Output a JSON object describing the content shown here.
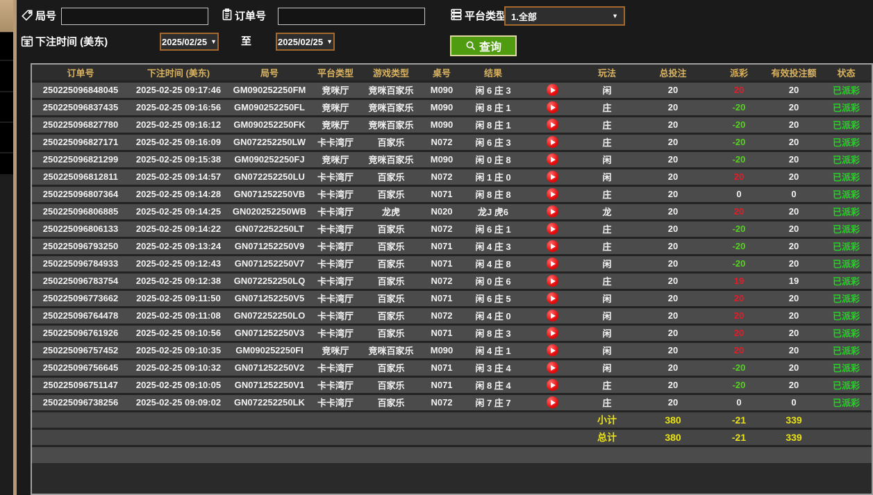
{
  "filters": {
    "round_label": "局号",
    "round_value": "",
    "order_label": "订单号",
    "order_value": "",
    "platform_label": "平台类型",
    "platform_value": "1.全部",
    "bet_time_label": "下注时间 (美东)",
    "date_from": "2025/02/25",
    "date_to": "2025/02/25",
    "to_label": "至",
    "search_label": "查询"
  },
  "colors": {
    "header_gold": "#d9b25f",
    "positive_red": "#e81a28",
    "negative_green": "#55d41e",
    "status_green": "#22d422",
    "totals_yellow": "#e9e217",
    "button_green": "#4f9c10",
    "dropdown_border_orange": "#a5692b",
    "rail_tan": "#b79a74"
  },
  "table": {
    "headers": [
      "订单号",
      "下注时间 (美东)",
      "局号",
      "平台类型",
      "游戏类型",
      "桌号",
      "结果",
      "玩法",
      "总投注",
      "派彩",
      "有效投注额",
      "状态"
    ],
    "rows": [
      {
        "order_no": "250225096848045",
        "bet_time": "2025-02-25 09:17:46",
        "round_no": "GM090252250FM",
        "platform": "竞咪厅",
        "game_type": "竞咪百家乐",
        "table_no": "M090",
        "result": "闲 6 庄 3",
        "play_type": "闲",
        "total_bet": "20",
        "payout": "20",
        "payout_class": "pos",
        "valid_bet": "20",
        "status": "已派彩"
      },
      {
        "order_no": "250225096837435",
        "bet_time": "2025-02-25 09:16:56",
        "round_no": "GM090252250FL",
        "platform": "竞咪厅",
        "game_type": "竞咪百家乐",
        "table_no": "M090",
        "result": "闲 8 庄 1",
        "play_type": "庄",
        "total_bet": "20",
        "payout": "-20",
        "payout_class": "neg",
        "valid_bet": "20",
        "status": "已派彩"
      },
      {
        "order_no": "250225096827780",
        "bet_time": "2025-02-25 09:16:12",
        "round_no": "GM090252250FK",
        "platform": "竞咪厅",
        "game_type": "竞咪百家乐",
        "table_no": "M090",
        "result": "闲 8 庄 1",
        "play_type": "庄",
        "total_bet": "20",
        "payout": "-20",
        "payout_class": "neg",
        "valid_bet": "20",
        "status": "已派彩"
      },
      {
        "order_no": "250225096827171",
        "bet_time": "2025-02-25 09:16:09",
        "round_no": "GN072252250LW",
        "platform": "卡卡湾厅",
        "game_type": "百家乐",
        "table_no": "N072",
        "result": "闲 6 庄 3",
        "play_type": "庄",
        "total_bet": "20",
        "payout": "-20",
        "payout_class": "neg",
        "valid_bet": "20",
        "status": "已派彩"
      },
      {
        "order_no": "250225096821299",
        "bet_time": "2025-02-25 09:15:38",
        "round_no": "GM090252250FJ",
        "platform": "竞咪厅",
        "game_type": "竞咪百家乐",
        "table_no": "M090",
        "result": "闲 0 庄 8",
        "play_type": "闲",
        "total_bet": "20",
        "payout": "-20",
        "payout_class": "neg",
        "valid_bet": "20",
        "status": "已派彩"
      },
      {
        "order_no": "250225096812811",
        "bet_time": "2025-02-25 09:14:57",
        "round_no": "GN072252250LU",
        "platform": "卡卡湾厅",
        "game_type": "百家乐",
        "table_no": "N072",
        "result": "闲 1 庄 0",
        "play_type": "闲",
        "total_bet": "20",
        "payout": "20",
        "payout_class": "pos",
        "valid_bet": "20",
        "status": "已派彩"
      },
      {
        "order_no": "250225096807364",
        "bet_time": "2025-02-25 09:14:28",
        "round_no": "GN071252250VB",
        "platform": "卡卡湾厅",
        "game_type": "百家乐",
        "table_no": "N071",
        "result": "闲 8 庄 8",
        "play_type": "庄",
        "total_bet": "20",
        "payout": "0",
        "payout_class": "zero",
        "valid_bet": "0",
        "status": "已派彩"
      },
      {
        "order_no": "250225096806885",
        "bet_time": "2025-02-25 09:14:25",
        "round_no": "GN020252250WB",
        "platform": "卡卡湾厅",
        "game_type": "龙虎",
        "table_no": "N020",
        "result": "龙J 虎6",
        "play_type": "龙",
        "total_bet": "20",
        "payout": "20",
        "payout_class": "pos",
        "valid_bet": "20",
        "status": "已派彩"
      },
      {
        "order_no": "250225096806133",
        "bet_time": "2025-02-25 09:14:22",
        "round_no": "GN072252250LT",
        "platform": "卡卡湾厅",
        "game_type": "百家乐",
        "table_no": "N072",
        "result": "闲 6 庄 1",
        "play_type": "庄",
        "total_bet": "20",
        "payout": "-20",
        "payout_class": "neg",
        "valid_bet": "20",
        "status": "已派彩"
      },
      {
        "order_no": "250225096793250",
        "bet_time": "2025-02-25 09:13:24",
        "round_no": "GN071252250V9",
        "platform": "卡卡湾厅",
        "game_type": "百家乐",
        "table_no": "N071",
        "result": "闲 4 庄 3",
        "play_type": "庄",
        "total_bet": "20",
        "payout": "-20",
        "payout_class": "neg",
        "valid_bet": "20",
        "status": "已派彩"
      },
      {
        "order_no": "250225096784933",
        "bet_time": "2025-02-25 09:12:43",
        "round_no": "GN071252250V7",
        "platform": "卡卡湾厅",
        "game_type": "百家乐",
        "table_no": "N071",
        "result": "闲 4 庄 8",
        "play_type": "闲",
        "total_bet": "20",
        "payout": "-20",
        "payout_class": "neg",
        "valid_bet": "20",
        "status": "已派彩"
      },
      {
        "order_no": "250225096783754",
        "bet_time": "2025-02-25 09:12:38",
        "round_no": "GN072252250LQ",
        "platform": "卡卡湾厅",
        "game_type": "百家乐",
        "table_no": "N072",
        "result": "闲 0 庄 6",
        "play_type": "庄",
        "total_bet": "20",
        "payout": "19",
        "payout_class": "pos",
        "valid_bet": "19",
        "status": "已派彩"
      },
      {
        "order_no": "250225096773662",
        "bet_time": "2025-02-25 09:11:50",
        "round_no": "GN071252250V5",
        "platform": "卡卡湾厅",
        "game_type": "百家乐",
        "table_no": "N071",
        "result": "闲 6 庄 5",
        "play_type": "闲",
        "total_bet": "20",
        "payout": "20",
        "payout_class": "pos",
        "valid_bet": "20",
        "status": "已派彩"
      },
      {
        "order_no": "250225096764478",
        "bet_time": "2025-02-25 09:11:08",
        "round_no": "GN072252250LO",
        "platform": "卡卡湾厅",
        "game_type": "百家乐",
        "table_no": "N072",
        "result": "闲 4 庄 0",
        "play_type": "闲",
        "total_bet": "20",
        "payout": "20",
        "payout_class": "pos",
        "valid_bet": "20",
        "status": "已派彩"
      },
      {
        "order_no": "250225096761926",
        "bet_time": "2025-02-25 09:10:56",
        "round_no": "GN071252250V3",
        "platform": "卡卡湾厅",
        "game_type": "百家乐",
        "table_no": "N071",
        "result": "闲 8 庄 3",
        "play_type": "闲",
        "total_bet": "20",
        "payout": "20",
        "payout_class": "pos",
        "valid_bet": "20",
        "status": "已派彩"
      },
      {
        "order_no": "250225096757452",
        "bet_time": "2025-02-25 09:10:35",
        "round_no": "GM090252250FI",
        "platform": "竞咪厅",
        "game_type": "竞咪百家乐",
        "table_no": "M090",
        "result": "闲 4 庄 1",
        "play_type": "闲",
        "total_bet": "20",
        "payout": "20",
        "payout_class": "pos",
        "valid_bet": "20",
        "status": "已派彩"
      },
      {
        "order_no": "250225096756645",
        "bet_time": "2025-02-25 09:10:32",
        "round_no": "GN071252250V2",
        "platform": "卡卡湾厅",
        "game_type": "百家乐",
        "table_no": "N071",
        "result": "闲 3 庄 4",
        "play_type": "闲",
        "total_bet": "20",
        "payout": "-20",
        "payout_class": "neg",
        "valid_bet": "20",
        "status": "已派彩"
      },
      {
        "order_no": "250225096751147",
        "bet_time": "2025-02-25 09:10:05",
        "round_no": "GN071252250V1",
        "platform": "卡卡湾厅",
        "game_type": "百家乐",
        "table_no": "N071",
        "result": "闲 8 庄 4",
        "play_type": "庄",
        "total_bet": "20",
        "payout": "-20",
        "payout_class": "neg",
        "valid_bet": "20",
        "status": "已派彩"
      },
      {
        "order_no": "250225096738256",
        "bet_time": "2025-02-25 09:09:02",
        "round_no": "GN072252250LK",
        "platform": "卡卡湾厅",
        "game_type": "百家乐",
        "table_no": "N072",
        "result": "闲 7 庄 7",
        "play_type": "庄",
        "total_bet": "20",
        "payout": "0",
        "payout_class": "zero",
        "valid_bet": "0",
        "status": "已派彩"
      }
    ],
    "subtotal": {
      "label": "小计",
      "total_bet": "380",
      "payout": "-21",
      "valid_bet": "339"
    },
    "total": {
      "label": "总计",
      "total_bet": "380",
      "payout": "-21",
      "valid_bet": "339"
    }
  }
}
